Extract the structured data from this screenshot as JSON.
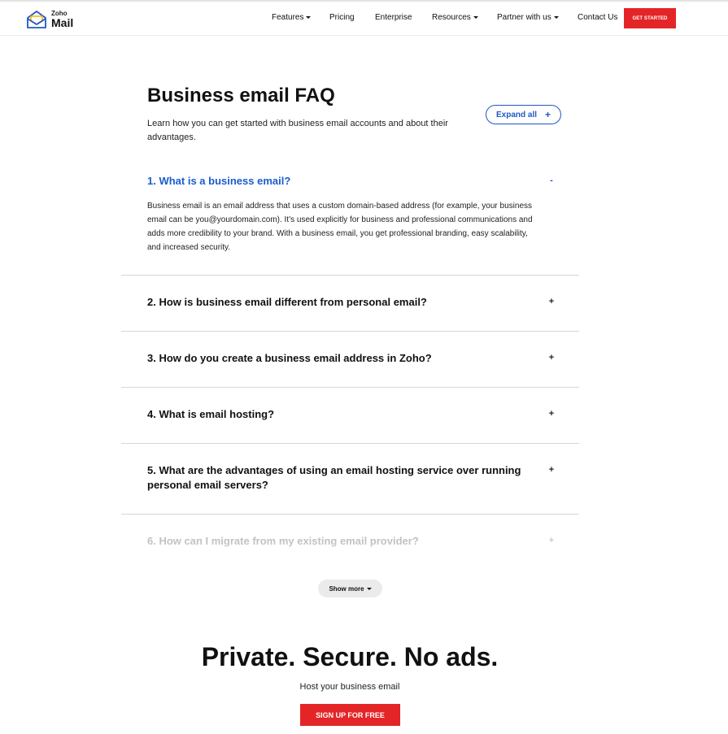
{
  "brand": {
    "logo_small": "Zoho",
    "logo_big": "Mail",
    "accent": "#e42527",
    "link_blue": "#1a5ccf"
  },
  "nav": {
    "features": "Features",
    "pricing": "Pricing",
    "enterprise": "Enterprise",
    "resources": "Resources",
    "partner": "Partner with us",
    "contact": "Contact Us",
    "cta": "GET STARTED"
  },
  "faq": {
    "title": "Business email FAQ",
    "subtitle": "Learn how you can get started with business email accounts and about their advantages.",
    "expand_label": "Expand all",
    "expand_icon": "+",
    "items": [
      {
        "question": "1. What is a business email?",
        "toggle": "-",
        "answer": "Business email is an email address that uses a custom domain-based address (for example, your business email can be you@yourdomain.com). It’s used explicitly for business and professional communications and adds more credibility to your brand. With a business email, you get professional branding, easy scalability, and increased security."
      },
      {
        "question": "2. How is business email different from personal email?",
        "toggle": "+"
      },
      {
        "question": "3. How do you create a business email address in Zoho?",
        "toggle": "+"
      },
      {
        "question": "4. What is email hosting?",
        "toggle": "+"
      },
      {
        "question": "5. What are the advantages of using an email hosting service over running personal email servers?",
        "toggle": "+"
      },
      {
        "question": "6. How can I migrate from my existing email provider?",
        "toggle": "+"
      }
    ],
    "show_more": "Show more"
  },
  "promo": {
    "title": "Private. Secure. No ads.",
    "subtitle": "Host your business email",
    "signup": "SIGN UP FOR FREE"
  }
}
